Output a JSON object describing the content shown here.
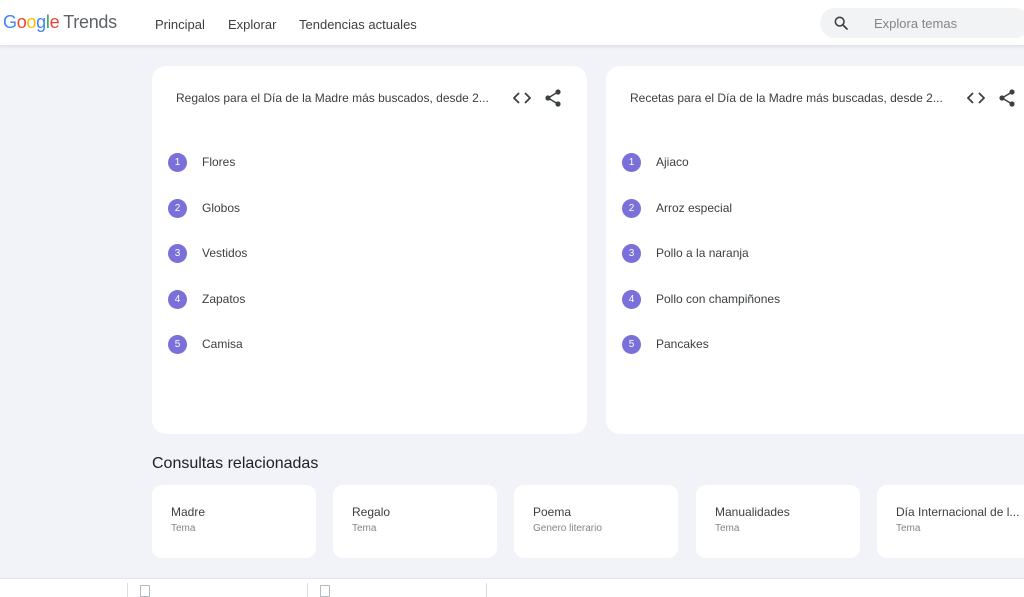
{
  "header": {
    "logo": {
      "g": "G",
      "o1": "o",
      "o2": "o",
      "g2": "g",
      "l": "l",
      "e": "e",
      "product": "Trends"
    },
    "nav": [
      "Principal",
      "Explorar",
      "Tendencias actuales"
    ],
    "search_placeholder": "Explora temas"
  },
  "cards": [
    {
      "title": "Regalos para el Día de la Madre más buscados, desde 2...",
      "items": [
        {
          "rank": "1",
          "label": "Flores"
        },
        {
          "rank": "2",
          "label": "Globos"
        },
        {
          "rank": "3",
          "label": "Vestidos"
        },
        {
          "rank": "4",
          "label": "Zapatos"
        },
        {
          "rank": "5",
          "label": "Camisa"
        }
      ]
    },
    {
      "title": "Recetas para el Día de la Madre más buscadas, desde 2...",
      "items": [
        {
          "rank": "1",
          "label": "Ajiaco"
        },
        {
          "rank": "2",
          "label": "Arroz especial"
        },
        {
          "rank": "3",
          "label": "Pollo a la naranja"
        },
        {
          "rank": "4",
          "label": "Pollo con champiñones"
        },
        {
          "rank": "5",
          "label": "Pancakes"
        }
      ]
    }
  ],
  "related": {
    "title": "Consultas relacionadas",
    "items": [
      {
        "title": "Madre",
        "type": "Tema"
      },
      {
        "title": "Regalo",
        "type": "Tema"
      },
      {
        "title": "Poema",
        "type": "Genero literario"
      },
      {
        "title": "Manualidades",
        "type": "Tema"
      },
      {
        "title": "Día Internacional de l...",
        "type": "Tema"
      }
    ]
  },
  "colors": {
    "rank_badge": "#7b6fd9",
    "background": "#f1f3f8",
    "card": "#ffffff"
  },
  "icons": {
    "search": "search-icon",
    "embed": "code-icon",
    "share": "share-icon"
  }
}
